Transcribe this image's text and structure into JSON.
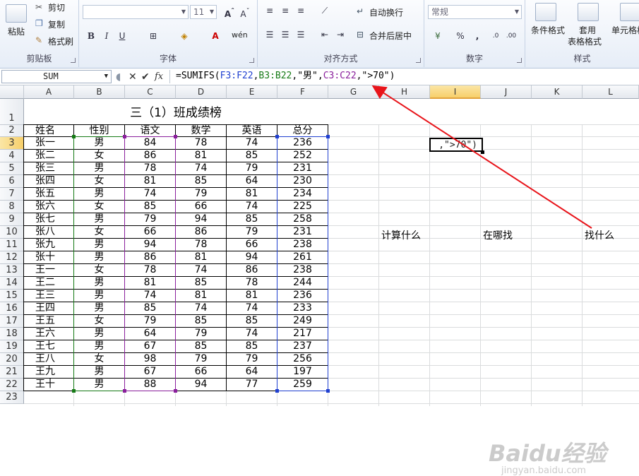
{
  "ribbon": {
    "clipboard": {
      "label": "剪贴板",
      "paste": "粘贴",
      "cut": "剪切",
      "copy": "复制",
      "format_painter": "格式刷"
    },
    "font": {
      "label": "字体",
      "font_size": "11",
      "bold": "B",
      "italic": "I",
      "underline": "U",
      "phonetic": "wén"
    },
    "alignment": {
      "label": "对齐方式",
      "wrap": "自动换行",
      "merge": "合并后居中"
    },
    "number": {
      "label": "数字",
      "format": "常规",
      "percent": "%",
      "comma": ","
    },
    "styles": {
      "label": "样式",
      "conditional": "条件格式",
      "table_format_1": "套用",
      "table_format_2": "表格格式",
      "cell_styles": "单元格格"
    }
  },
  "formula_bar": {
    "name_box": "SUM",
    "fx": "fx",
    "formula_parts": [
      {
        "text": "=SUMIFS(",
        "color": "#000000"
      },
      {
        "text": "F3:F22",
        "color": "#1f3fd0"
      },
      {
        "text": ",",
        "color": "#000000"
      },
      {
        "text": "B3:B22",
        "color": "#167a16"
      },
      {
        "text": ",\"男\",",
        "color": "#000000"
      },
      {
        "text": "C3:C22",
        "color": "#8a1f9c"
      },
      {
        "text": ",\">70\")",
        "color": "#000000"
      }
    ]
  },
  "columns": [
    "A",
    "B",
    "C",
    "D",
    "E",
    "F",
    "G",
    "H",
    "I",
    "J",
    "K",
    "L"
  ],
  "selected_column": "I",
  "selected_row": "3",
  "rows": [
    "1",
    "2",
    "3",
    "4",
    "5",
    "6",
    "7",
    "8",
    "9",
    "10",
    "11",
    "12",
    "13",
    "14",
    "15",
    "16",
    "17",
    "18",
    "19",
    "20",
    "21",
    "22",
    "23"
  ],
  "table": {
    "title": "三（1）班成绩榜",
    "headers": [
      "姓名",
      "性别",
      "语文",
      "数学",
      "英语",
      "总分"
    ],
    "data": [
      [
        "张一",
        "男",
        "84",
        "78",
        "74",
        "236"
      ],
      [
        "张二",
        "女",
        "86",
        "81",
        "85",
        "252"
      ],
      [
        "张三",
        "男",
        "78",
        "74",
        "79",
        "231"
      ],
      [
        "张四",
        "女",
        "81",
        "85",
        "64",
        "230"
      ],
      [
        "张五",
        "男",
        "74",
        "79",
        "81",
        "234"
      ],
      [
        "张六",
        "女",
        "85",
        "66",
        "74",
        "225"
      ],
      [
        "张七",
        "男",
        "79",
        "94",
        "85",
        "258"
      ],
      [
        "张八",
        "女",
        "66",
        "86",
        "79",
        "231"
      ],
      [
        "张九",
        "男",
        "94",
        "78",
        "66",
        "238"
      ],
      [
        "张十",
        "男",
        "86",
        "81",
        "94",
        "261"
      ],
      [
        "王一",
        "女",
        "78",
        "74",
        "86",
        "238"
      ],
      [
        "王二",
        "男",
        "81",
        "85",
        "78",
        "244"
      ],
      [
        "王三",
        "男",
        "74",
        "81",
        "81",
        "236"
      ],
      [
        "王四",
        "男",
        "85",
        "74",
        "74",
        "233"
      ],
      [
        "王五",
        "女",
        "79",
        "85",
        "85",
        "249"
      ],
      [
        "王六",
        "男",
        "64",
        "79",
        "74",
        "217"
      ],
      [
        "王七",
        "男",
        "67",
        "85",
        "85",
        "237"
      ],
      [
        "王八",
        "女",
        "98",
        "79",
        "79",
        "256"
      ],
      [
        "王九",
        "男",
        "67",
        "66",
        "64",
        "197"
      ],
      [
        "王十",
        "男",
        "88",
        "94",
        "77",
        "259"
      ]
    ]
  },
  "active_cell": {
    "ref": "I3",
    "text": ",\">70\")"
  },
  "annotations": {
    "what_to_sum": "计算什么",
    "where_to_find": "在哪找",
    "what_to_find": "找什么"
  },
  "arrow_color": "#e8141a",
  "watermark": {
    "main": "Baidu经验",
    "sub": "jingyan.baidu.com"
  }
}
